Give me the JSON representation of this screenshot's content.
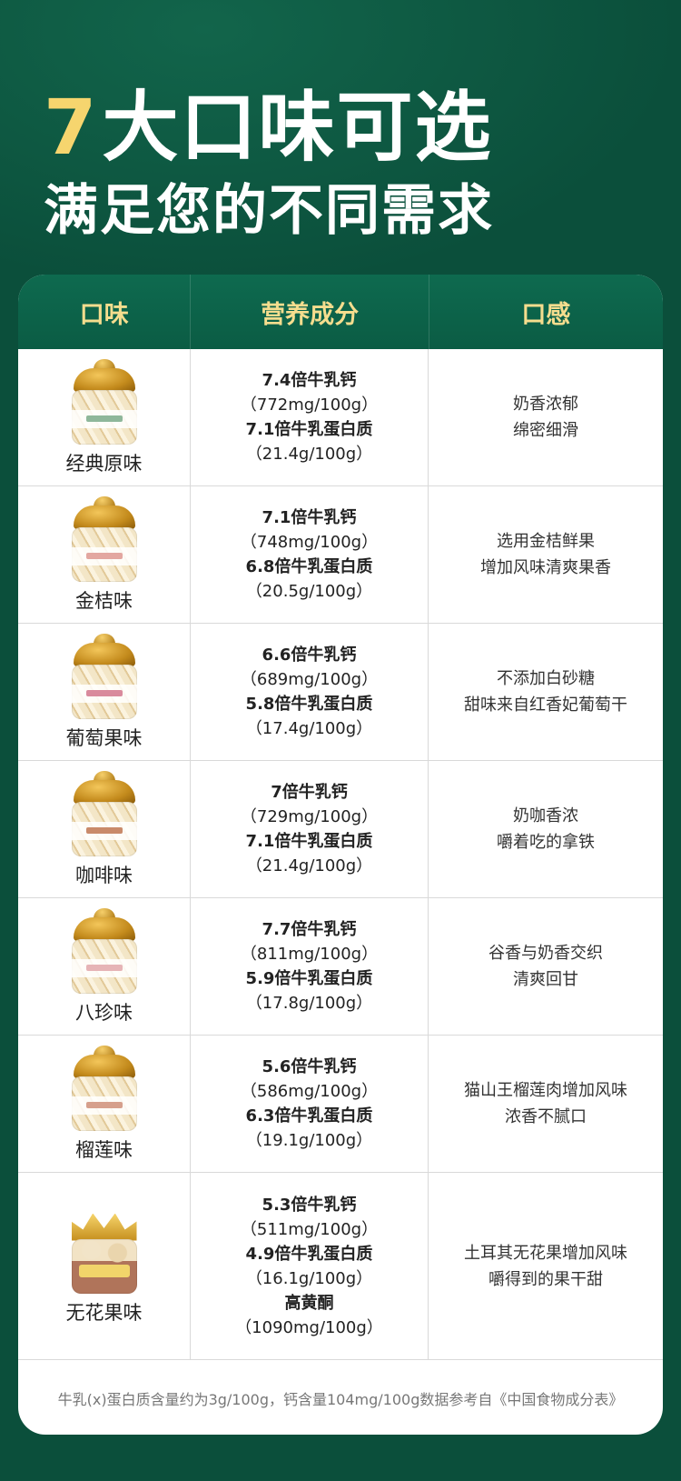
{
  "header": {
    "title_number": "7",
    "title_text": "大口味可选",
    "subtitle": "满足您的不同需求"
  },
  "table": {
    "columns": [
      "口味",
      "营养成分",
      "口感"
    ],
    "rows": [
      {
        "flavor": "经典原味",
        "calcium_multiple": "7.4倍牛乳钙",
        "calcium_value": "（772mg/100g）",
        "protein_multiple": "7.1倍牛乳蛋白质",
        "protein_value": "（21.4g/100g）",
        "taste_line1": "奶香浓郁",
        "taste_line2": "绵密细滑"
      },
      {
        "flavor": "金桔味",
        "calcium_multiple": "7.1倍牛乳钙",
        "calcium_value": "（748mg/100g）",
        "protein_multiple": "6.8倍牛乳蛋白质",
        "protein_value": "（20.5g/100g）",
        "taste_line1": "选用金桔鲜果",
        "taste_line2": "增加风味清爽果香"
      },
      {
        "flavor": "葡萄果味",
        "calcium_multiple": "6.6倍牛乳钙",
        "calcium_value": "（689mg/100g）",
        "protein_multiple": "5.8倍牛乳蛋白质",
        "protein_value": "（17.4g/100g）",
        "taste_line1": "不添加白砂糖",
        "taste_line2": "甜味来自红香妃葡萄干"
      },
      {
        "flavor": "咖啡味",
        "calcium_multiple": "7倍牛乳钙",
        "calcium_value": "（729mg/100g）",
        "protein_multiple": "7.1倍牛乳蛋白质",
        "protein_value": "（21.4g/100g）",
        "taste_line1": "奶咖香浓",
        "taste_line2": "嚼着吃的拿铁"
      },
      {
        "flavor": "八珍味",
        "calcium_multiple": "7.7倍牛乳钙",
        "calcium_value": "（811mg/100g）",
        "protein_multiple": "5.9倍牛乳蛋白质",
        "protein_value": "（17.8g/100g）",
        "taste_line1": "谷香与奶香交织",
        "taste_line2": "清爽回甘"
      },
      {
        "flavor": "榴莲味",
        "calcium_multiple": "5.6倍牛乳钙",
        "calcium_value": "（586mg/100g）",
        "protein_multiple": "6.3倍牛乳蛋白质",
        "protein_value": "（19.1g/100g）",
        "taste_line1": "猫山王榴莲肉增加风味",
        "taste_line2": "浓香不腻口"
      },
      {
        "flavor": "无花果味",
        "calcium_multiple": "5.3倍牛乳钙",
        "calcium_value": "（511mg/100g）",
        "protein_multiple": "4.9倍牛乳蛋白质",
        "protein_value": "（16.1g/100g）",
        "extra_label": "高黄酮",
        "extra_value": "（1090mg/100g）",
        "taste_line1": "土耳其无花果增加风味",
        "taste_line2": "嚼得到的果干甜"
      }
    ]
  },
  "footnote": "牛乳(x)蛋白质含量约为3g/100g，钙含量104mg/100g数据参考自《中国食物成分表》",
  "colors": {
    "background": "#0b4f3b",
    "header_text": "#f5dd8e",
    "title_accent": "#f6d56e",
    "jar_accents": [
      "#8fb79a",
      "#e3a7a0",
      "#d98a9c",
      "#c98a6a",
      "#e6b4b6",
      "#d6a08c",
      "#f1d46a"
    ]
  }
}
